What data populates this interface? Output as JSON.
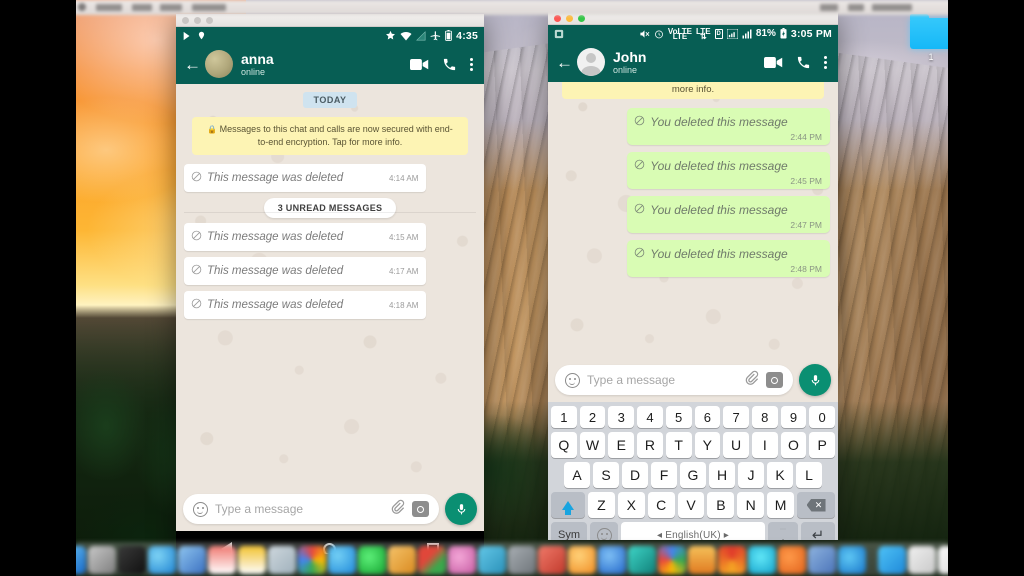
{
  "desktop": {
    "folder": {
      "name": "folder-icon",
      "label": "1"
    },
    "menubar_apple": "apple-menu-icon"
  },
  "window_left": {
    "traffic_lights": [
      "close",
      "minimize",
      "zoom"
    ],
    "status_bar": {
      "left_icons": [
        "play-store-icon",
        "location-pin-icon"
      ],
      "right_icons": [
        "star-icon",
        "wifi-icon",
        "signal-icon",
        "airplane-icon",
        "battery-icon"
      ],
      "time": "4:35"
    },
    "header": {
      "back": "←",
      "contact_name": "anna",
      "contact_status": "online",
      "actions": [
        "video-call-icon",
        "voice-call-icon",
        "overflow-menu-icon"
      ]
    },
    "chat": {
      "day_chip": "TODAY",
      "encryption_banner": "Messages to this chat and calls are now secured with end-to-end encryption. Tap for more info.",
      "unread_divider": "3 UNREAD MESSAGES",
      "messages_before": [
        {
          "text": "This message was deleted",
          "time": "4:14 AM",
          "type": "incoming"
        }
      ],
      "messages_after": [
        {
          "text": "This message was deleted",
          "time": "4:15 AM",
          "type": "incoming"
        },
        {
          "text": "This message was deleted",
          "time": "4:17 AM",
          "type": "incoming"
        },
        {
          "text": "This message was deleted",
          "time": "4:18 AM",
          "type": "incoming"
        }
      ]
    },
    "input": {
      "placeholder": "Type a message",
      "emoji": "emoji-icon",
      "attach": "paperclip-icon",
      "camera": "camera-icon",
      "mic": "microphone-icon"
    },
    "navbar": [
      "back-nav-button",
      "home-nav-button",
      "recents-nav-button"
    ]
  },
  "window_right": {
    "traffic_lights": [
      "close",
      "minimize",
      "zoom"
    ],
    "status_bar": {
      "left_icons": [
        "app-icon"
      ],
      "right_icons": [
        "mute-icon",
        "alarm-icon",
        "volte-icon",
        "lte-icon",
        "sim-icon",
        "signal-1-icon",
        "signal-2-icon"
      ],
      "volte_label": "VoLTE",
      "lte_label": "LTE",
      "sim_label": "D",
      "battery_percent": "81%",
      "time": "3:05 PM"
    },
    "header": {
      "back": "←",
      "contact_name": "John",
      "contact_status": "online",
      "actions": [
        "video-call-icon",
        "voice-call-icon",
        "overflow-menu-icon"
      ]
    },
    "chat": {
      "encryption_banner_partial": "more info.",
      "messages": [
        {
          "text": "You deleted this message",
          "time": "2:44 PM",
          "type": "outgoing"
        },
        {
          "text": "You deleted this message",
          "time": "2:45 PM",
          "type": "outgoing"
        },
        {
          "text": "You deleted this message",
          "time": "2:47 PM",
          "type": "outgoing"
        },
        {
          "text": "You deleted this message",
          "time": "2:48 PM",
          "type": "outgoing"
        }
      ]
    },
    "input": {
      "placeholder": "Type a message",
      "emoji": "emoji-icon",
      "attach": "paperclip-icon",
      "camera": "camera-icon",
      "mic": "microphone-icon"
    },
    "keyboard": {
      "row_numbers": [
        "1",
        "2",
        "3",
        "4",
        "5",
        "6",
        "7",
        "8",
        "9",
        "0"
      ],
      "row_top": [
        "Q",
        "W",
        "E",
        "R",
        "T",
        "Y",
        "U",
        "I",
        "O",
        "P"
      ],
      "row_home": [
        "A",
        "S",
        "D",
        "F",
        "G",
        "H",
        "J",
        "K",
        "L"
      ],
      "row_bottom": [
        "Z",
        "X",
        "C",
        "V",
        "B",
        "N",
        "M"
      ],
      "shift": "shift-key",
      "backspace": "backspace-key",
      "sym_label": "Sym",
      "emoji_key": "emoji-key",
      "space_label": "◂ English(UK) ▸",
      "period_label": ".",
      "enter": "↵"
    }
  },
  "dock": {
    "icons": [
      "#2e8bd8",
      "#9a9a9a",
      "#1c1c1c",
      "#1e9ae0",
      "#3a7fd5",
      "#e8544a",
      "#f2c230",
      "#c8d3dc",
      "#e2533a",
      "#2aa4e8",
      "#2bcc4a",
      "#e8a33d",
      "#d94a3a",
      "#e060a8",
      "#3ab0d8",
      "#7b7f84",
      "#e04a3a"
    ],
    "icons_right": [
      "#f0952a",
      "#2d7fe0",
      "#18b0a0",
      "#3ba84c",
      "#e89a2a",
      "#e03a2a",
      "#22c6e0",
      "#f07a2a",
      "#5a8fd0",
      "#2aa0e8"
    ],
    "icons_far_right": [
      "#3ab8f0",
      "#e8e8e8",
      "#f2f2f2"
    ],
    "colors": {
      "separator": "rgba(255,255,255,0.28)"
    }
  },
  "theme": {
    "whatsapp_green": "#075e54",
    "whatsapp_mic_green": "#0a8f72",
    "outgoing_bubble": "#d9fcb4",
    "incoming_bubble": "#ffffff",
    "chat_background": "#ece5dd",
    "encryption_yellow": "#fdf4b4",
    "day_chip_blue": "#cfe3ef"
  }
}
